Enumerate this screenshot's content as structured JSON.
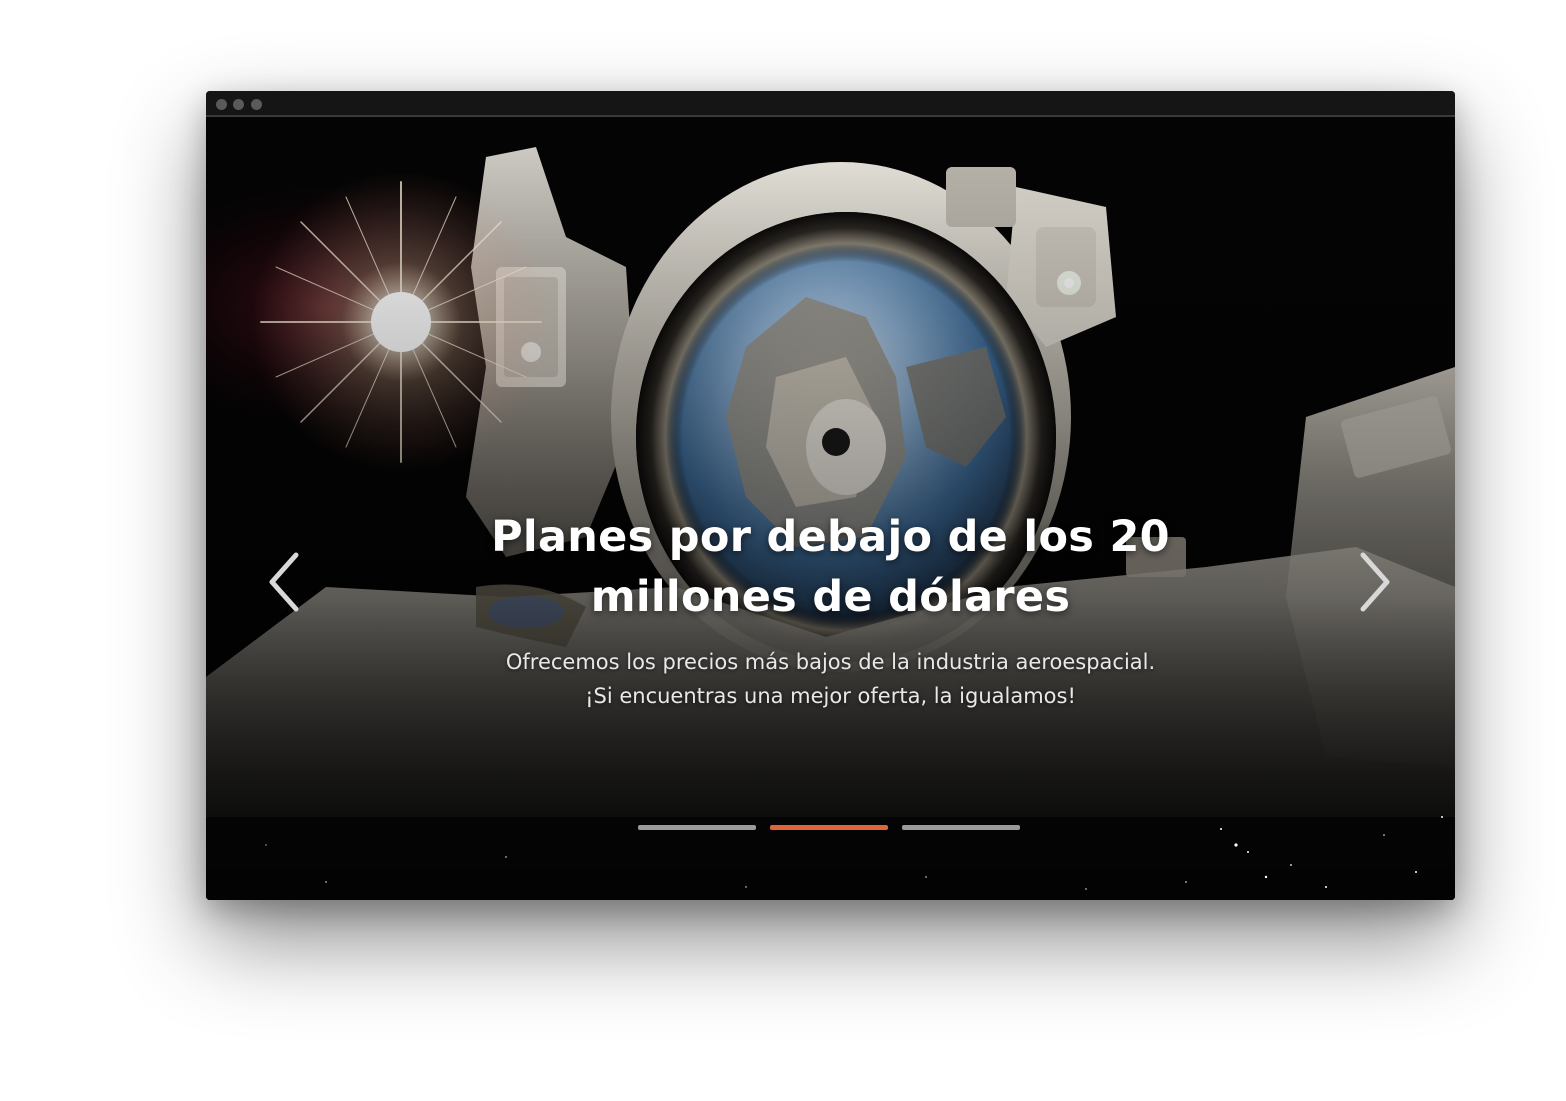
{
  "carousel": {
    "title_lines": [
      "Planes por debajo de los 20",
      "millones de dólares"
    ],
    "description_lines": [
      "Ofrecemos los precios más bajos de la industria aeroespacial.",
      "¡Si encuentras una mejor oferta, la igualamos!"
    ],
    "prev_icon": "chevron-left-icon",
    "next_icon": "chevron-right-icon",
    "slide_count": 3,
    "active_slide": 2
  },
  "colors": {
    "accent": "#e0643a",
    "indicator_inactive": "#9a9a9a",
    "background": "#000000",
    "titlebar": "#151515"
  }
}
